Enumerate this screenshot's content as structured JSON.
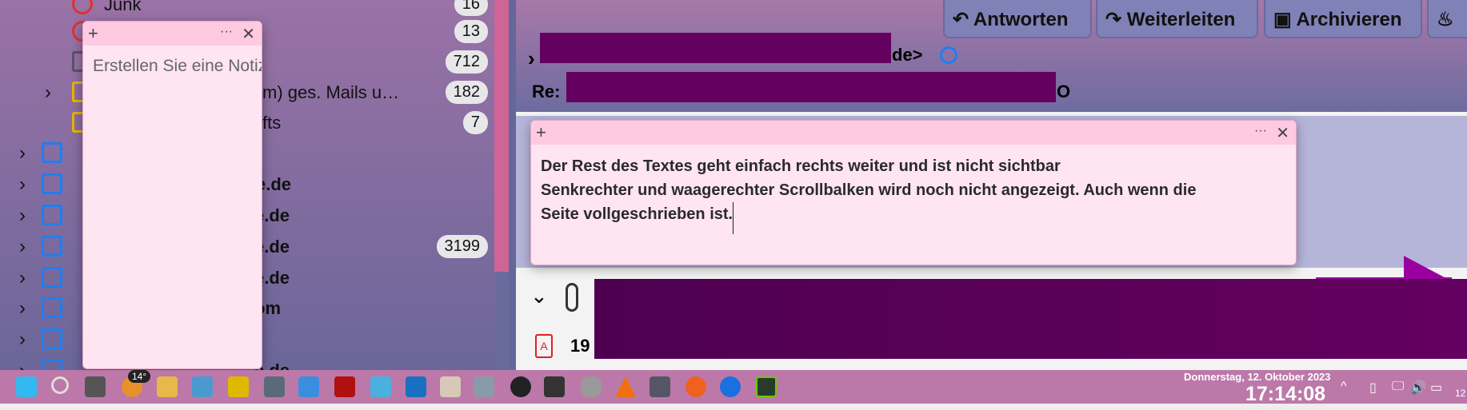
{
  "folders": [
    {
      "label": "Junk",
      "count": "16"
    },
    {
      "label": "",
      "count": "13"
    },
    {
      "label": "",
      "count": "712"
    },
    {
      "label": "m) ges. Mails u…",
      "count": "182"
    },
    {
      "label": "fts",
      "count": "7"
    }
  ],
  "accounts": [
    {
      "label": ""
    },
    {
      "label": "e.de"
    },
    {
      "label": "e.de"
    },
    {
      "label": "e.de",
      "count": "3199"
    },
    {
      "label": "e.de"
    },
    {
      "label": "om"
    },
    {
      "label": ""
    },
    {
      "label": "e.de"
    }
  ],
  "toolbar": {
    "reply": "Antworten",
    "forward": "Weiterleiten",
    "archive": "Archivieren"
  },
  "message": {
    "from_suffix": "de>",
    "subject_prefix": "Re:",
    "subject_suffix": "O",
    "attachment_name": "19"
  },
  "note_small": {
    "placeholder": "Erstellen Sie eine Notiz..."
  },
  "note_large": {
    "line1": "Der Rest des Textes geht einfach rechts weiter und ist nicht sichtbar",
    "line2": "Senkrechter und waagerechter Scrollbalken wird noch nicht angezeigt. Auch wenn die",
    "line3": "Seite vollgeschrieben ist."
  },
  "taskbar": {
    "weather": "14°",
    "date": "Donnerstag, 12. Oktober 2023",
    "time": "17:14:08",
    "tray_partial": "12"
  },
  "colors": {
    "redaction": "#640060",
    "note": "#ffe4f1",
    "taskbar": "#bc78a8"
  }
}
